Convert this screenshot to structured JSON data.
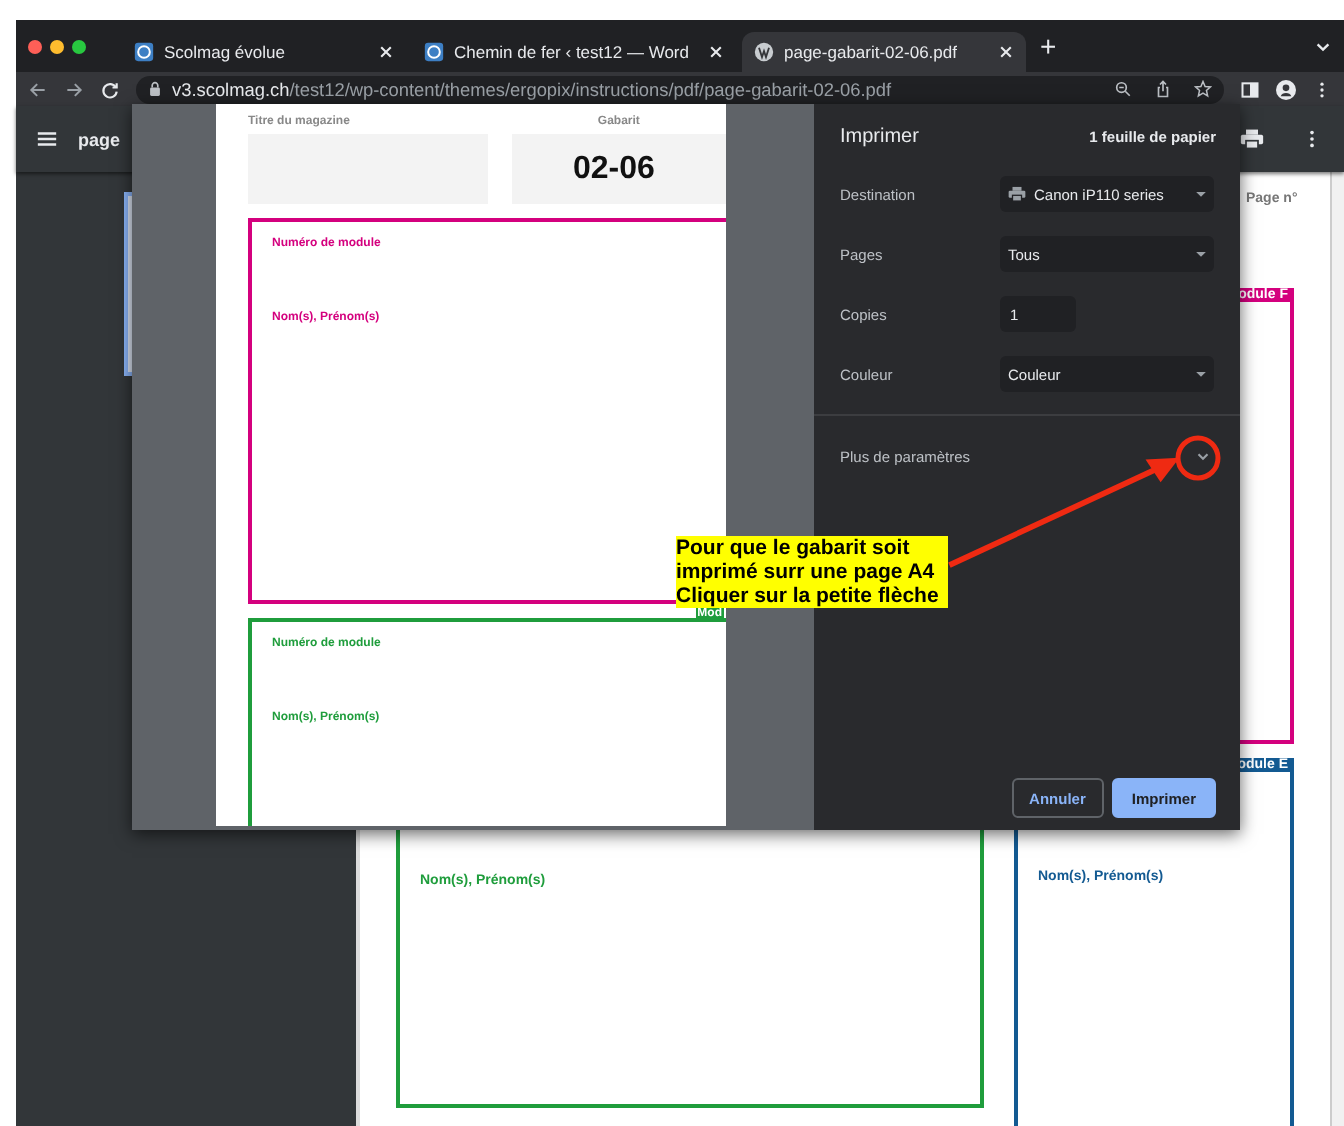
{
  "browser": {
    "tabs": [
      {
        "title": "Scolmag évolue",
        "selected": false
      },
      {
        "title": "Chemin de fer ‹ test12 — Word",
        "selected": false
      },
      {
        "title": "page-gabarit-02-06.pdf",
        "selected": true
      }
    ],
    "new_tab": "+",
    "url": {
      "host": "v3.scolmag.ch",
      "path": "/test12/wp-content/themes/ergopix/instructions/pdf/page-gabarit-02-06.pdf"
    }
  },
  "pdf_viewer": {
    "title": "page",
    "page": {
      "page_label": "Page n°",
      "modules": [
        {
          "kind": "side",
          "label": "odule F",
          "color": "#d4007e"
        },
        {
          "kind": "main",
          "name_label": "Nom(s), Prénom(s)",
          "color": "#1f9d3c"
        },
        {
          "kind": "small",
          "label": "odule E",
          "name_label": "Nom(s), Prénom(s)",
          "color": "#135a92"
        }
      ]
    }
  },
  "print_dialog": {
    "preview": {
      "magazine_label": "Titre du magazine",
      "template_label": "Gabarit",
      "template_number": "02-06",
      "modules": [
        {
          "number_label": "Numéro de module",
          "name_label": "Nom(s), Prénom(s)",
          "color": "#d4007e"
        },
        {
          "tag": "Mod",
          "number_label": "Numéro de module",
          "name_label": "Nom(s), Prénom(s)",
          "color": "#1f9d3c"
        }
      ]
    },
    "title": "Imprimer",
    "sheets": "1 feuille de papier",
    "settings": [
      {
        "kind": "select",
        "label": "Destination",
        "value": "Canon iP110 series",
        "printer_icon": true
      },
      {
        "kind": "select",
        "label": "Pages",
        "value": "Tous",
        "printer_icon": false
      },
      {
        "kind": "input",
        "label": "Copies",
        "value": "1"
      },
      {
        "kind": "select",
        "label": "Couleur",
        "value": "Couleur",
        "printer_icon": false
      }
    ],
    "more_settings": {
      "label": "Plus de paramètres",
      "expanded": false
    },
    "buttons": [
      {
        "label": "Annuler",
        "primary": false
      },
      {
        "label": "Imprimer",
        "primary": true
      }
    ]
  },
  "annotation": {
    "lines": [
      "Pour que le gabarit soit",
      "imprimé surr une page A4",
      "Cliquer sur la petite flèche"
    ]
  }
}
